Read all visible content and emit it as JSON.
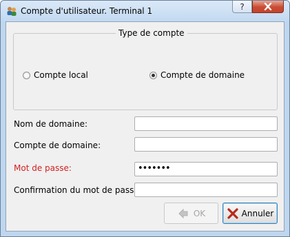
{
  "window": {
    "title": "Compte d'utilisateur. Terminal 1"
  },
  "titlebar": {
    "help_label": "?"
  },
  "account_type": {
    "title": "Type de compte",
    "options": [
      {
        "label": "Compte local",
        "selected": false
      },
      {
        "label": "Compte de domaine",
        "selected": true
      }
    ]
  },
  "form": {
    "domain_name_label": "Nom de domaine:",
    "domain_name_value": "",
    "domain_account_label": "Compte de domaine:",
    "domain_account_value": "",
    "password_label": "Mot de passe:",
    "password_label_color": "#d32020",
    "password_value": "•••••••",
    "confirm_label": "Confirmation du mot de passe:",
    "confirm_value": ""
  },
  "buttons": {
    "ok_label": "OK",
    "cancel_label": "Annuler"
  },
  "colors": {
    "title_bar": "#c2d9f0",
    "close_button": "#c84c33",
    "cancel_icon": "#b8291b"
  }
}
